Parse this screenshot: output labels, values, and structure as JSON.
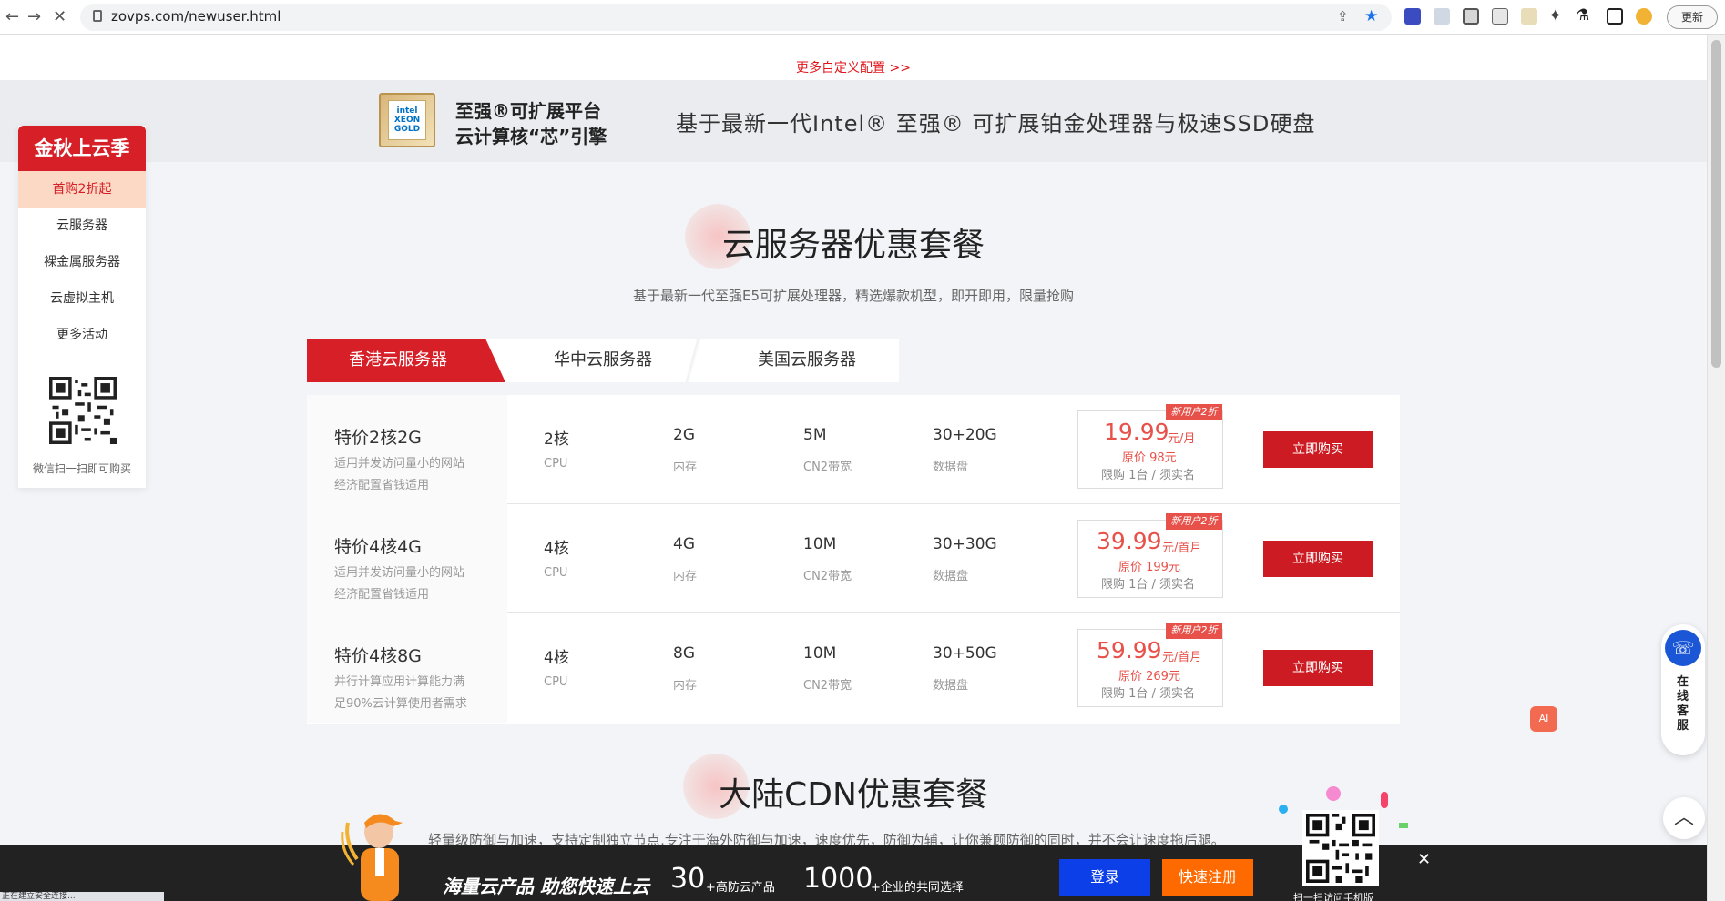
{
  "browser": {
    "url": "zovps.com/newuser.html",
    "update_label": "更新",
    "back_icon": "←",
    "forward_icon": "→",
    "reload_icon": "✕"
  },
  "top": {
    "more_config": "更多自定义配置 >>"
  },
  "intel_banner": {
    "logo_text": "intel XEON GOLD",
    "title_line1": "至强®可扩展平台",
    "title_line2": "云计算核“芯”引擎",
    "headline": "基于最新一代Intel® 至强® 可扩展铂金处理器与极速SSD硬盘"
  },
  "sidebar": {
    "header": "金秋上云季",
    "items": [
      {
        "label": "首购2折起",
        "active": true
      },
      {
        "label": "云服务器"
      },
      {
        "label": "裸金属服务器"
      },
      {
        "label": "云虚拟主机"
      },
      {
        "label": "更多活动"
      }
    ],
    "qr_caption": "微信扫一扫即可购买"
  },
  "section1": {
    "title": "云服务器优惠套餐",
    "subtitle": "基于最新一代至强E5可扩展处理器，精选爆款机型，即开即用，限量抢购",
    "tabs": [
      {
        "label": "香港云服务器",
        "active": true
      },
      {
        "label": "华中云服务器"
      },
      {
        "label": "美国云服务器"
      }
    ],
    "spec_labels": {
      "cpu": "CPU",
      "mem": "内存",
      "bw": "CN2带宽",
      "disk": "数据盘"
    },
    "products": [
      {
        "name": "特价2核2G",
        "desc1": "适用并发访问量小的网站",
        "desc2": "经济配置省钱适用",
        "cpu": "2核",
        "mem": "2G",
        "bw": "5M",
        "disk": "30+20G",
        "badge": "新用户2折",
        "price": "19.99",
        "unit": "元/月",
        "orig": "原价 98元",
        "limit": "限购 1台 / 须实名",
        "buy": "立即购买"
      },
      {
        "name": "特价4核4G",
        "desc1": "适用并发访问量小的网站",
        "desc2": "经济配置省钱适用",
        "cpu": "4核",
        "mem": "4G",
        "bw": "10M",
        "disk": "30+30G",
        "badge": "新用户2折",
        "price": "39.99",
        "unit": "元/首月",
        "orig": "原价 199元",
        "limit": "限购 1台 / 须实名",
        "buy": "立即购买"
      },
      {
        "name": "特价4核8G",
        "desc1": "并行计算应用计算能力满",
        "desc2": "足90%云计算使用者需求",
        "cpu": "4核",
        "mem": "8G",
        "bw": "10M",
        "disk": "30+50G",
        "badge": "新用户2折",
        "price": "59.99",
        "unit": "元/首月",
        "orig": "原价 269元",
        "limit": "限购 1台 / 须实名",
        "buy": "立即购买"
      }
    ]
  },
  "section2": {
    "title": "大陆CDN优惠套餐",
    "subtitle": "轻量级防御与加速，支持定制独立节点,专注于海外防御与加速，速度优先，防御为辅，让你兼顾防御的同时，并不会让速度拖后腿。"
  },
  "widgets": {
    "ai_label": "AI",
    "service_text": "在线客服",
    "phone_icon": "☏",
    "totop_icon": "︿"
  },
  "promo": {
    "slogan": "海量云产品 助您快速上云",
    "num1": "30",
    "label1": "+高防云产品",
    "num2": "1000",
    "label2": "+企业的共同选择",
    "login": "登录",
    "register": "快速注册",
    "qr_caption": "扫一扫访问手机版",
    "close": "✕"
  },
  "status": {
    "text": "正在建立安全连接..."
  },
  "colors": {
    "brand_red": "#d61f27",
    "price_red": "#e8514a",
    "login_blue": "#0d3fe8",
    "register_orange": "#ff6a00"
  }
}
